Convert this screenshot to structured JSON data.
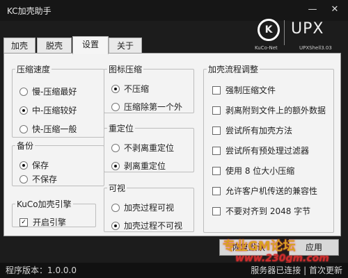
{
  "window": {
    "title": "KC加壳助手",
    "minimize": "—",
    "close": "✕"
  },
  "brand": {
    "logo": "K",
    "name": "UPX",
    "sub_left": "KuCo-Net",
    "sub_right": "UPXShell3.03"
  },
  "tabs": [
    {
      "label": "加壳",
      "active": false
    },
    {
      "label": "脱壳",
      "active": false
    },
    {
      "label": "设置",
      "active": true
    },
    {
      "label": "关于",
      "active": false
    }
  ],
  "compression_speed": {
    "title": "压缩速度",
    "options": [
      "慢-压缩最好",
      "中-压缩较好",
      "快-压缩一般"
    ],
    "selected": 1
  },
  "backup": {
    "title": "备份",
    "options": [
      "保存",
      "不保存"
    ],
    "selected": 0
  },
  "engine": {
    "title": "KuCo加壳引擎",
    "option": "开启引擎",
    "checked": true
  },
  "icon_compression": {
    "title": "图标压缩",
    "options": [
      "不压缩",
      "压缩除第一个外"
    ],
    "selected": 0
  },
  "relocation": {
    "title": "重定位",
    "options": [
      "不剥离重定位",
      "剥离重定位"
    ],
    "selected": 1
  },
  "visible": {
    "title": "可视",
    "options": [
      "加壳过程可视",
      "加壳过程不可视"
    ],
    "selected": 1
  },
  "process_adjust": {
    "title": "加壳流程调整",
    "options": [
      "强制压缩文件",
      "剥离附到文件上的额外数据",
      "尝试所有加壳方法",
      "尝试所有预处理过滤器",
      "使用 8 位大小压缩",
      "允许客户机传送的兼容性",
      "不要对齐到 2048 字节"
    ]
  },
  "actions": {
    "restore_default": "恢复默认",
    "apply": "应用"
  },
  "watermark": {
    "line1": "专业GM论坛",
    "line2": "www.230gm.com"
  },
  "status": {
    "version": "程序版本：1.0.0.0",
    "server": "服务器已连接",
    "updated": "首次更新"
  }
}
